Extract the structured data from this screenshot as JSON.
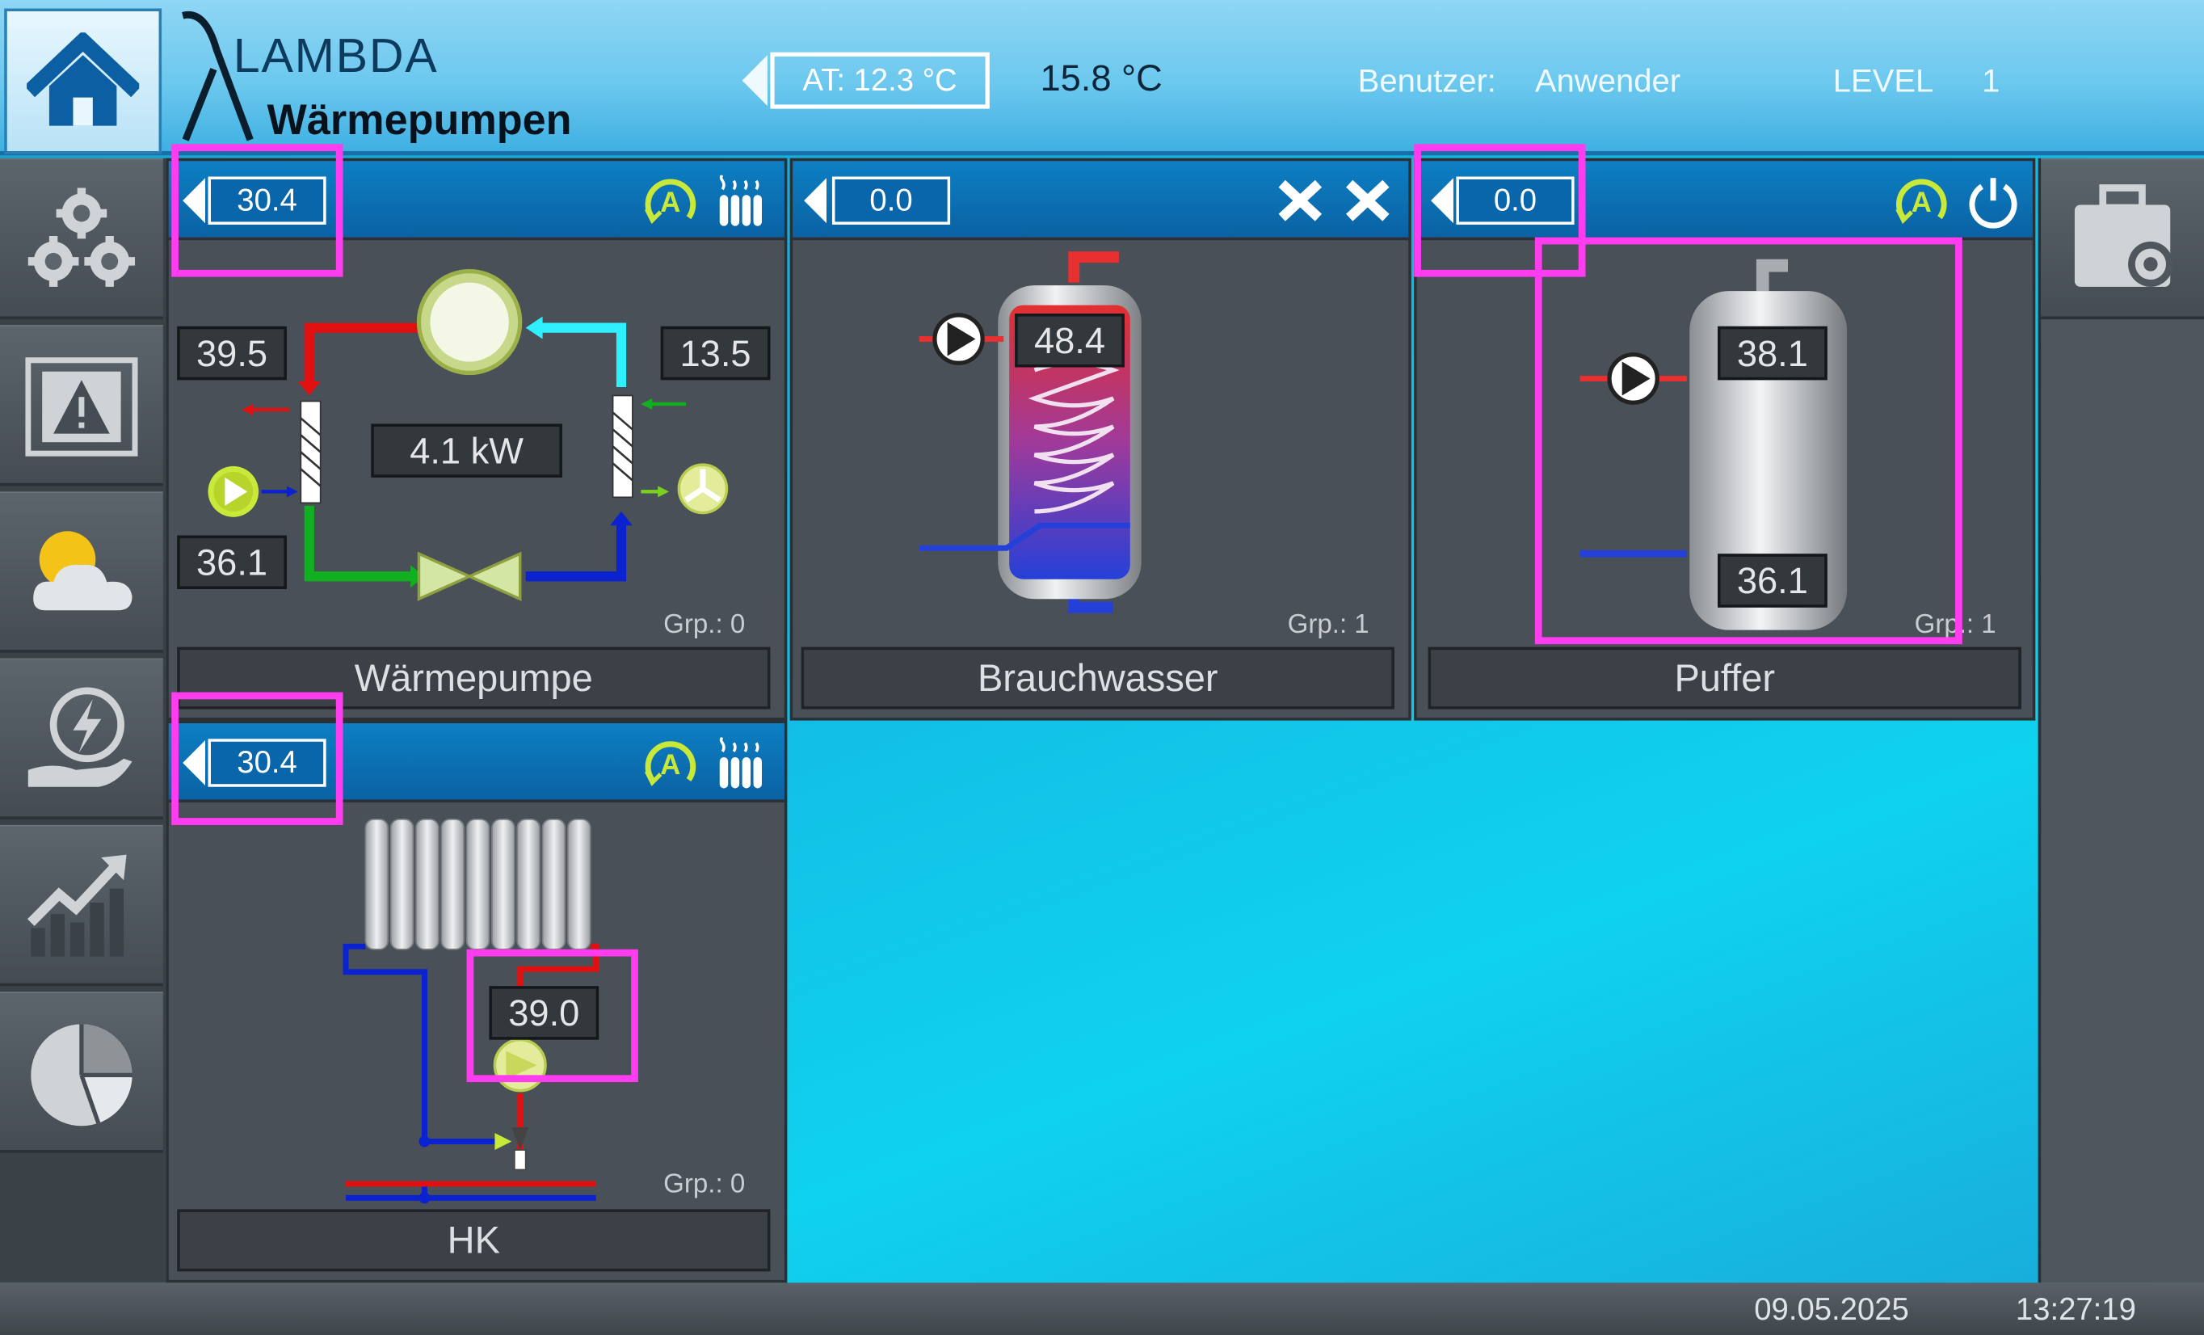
{
  "header": {
    "logo_line1": "LAMBDA",
    "logo_line2": "Wärmepumpen",
    "outside_temp": "AT: 12.3 °C",
    "temp2": "15.8 °C",
    "user_label": "Benutzer:",
    "user_value": "Anwender",
    "level_label": "LEVEL",
    "level_value": "1"
  },
  "left_sidebar": [
    "home-icon",
    "settings-gears-icon",
    "alarm-warning-icon",
    "weather-icon",
    "energy-icon",
    "statistics-icon",
    "pie-chart-icon"
  ],
  "right_sidebar": [
    "service-toolbox-icon"
  ],
  "panels": {
    "heatpump": {
      "setpoint": "30.4",
      "flow_temp": "39.5",
      "source_temp": "13.5",
      "return_temp": "36.1",
      "power": "4.1 kW",
      "group": "Grp.: 0",
      "label": "Wärmepumpe",
      "icons": [
        "auto-mode-icon",
        "heating-icon"
      ]
    },
    "brauchwasser": {
      "setpoint": "0.0",
      "tank_temp": "48.4",
      "group": "Grp.: 1",
      "label": "Brauchwasser",
      "icons": [
        "off-x-icon",
        "off-x-icon"
      ]
    },
    "puffer": {
      "setpoint": "0.0",
      "top_temp": "38.1",
      "bottom_temp": "36.1",
      "group": "Grp.: 1",
      "label": "Puffer",
      "icons": [
        "auto-mode-icon",
        "power-icon"
      ]
    },
    "hk": {
      "setpoint": "30.4",
      "flow_temp": "39.0",
      "group": "Grp.: 0",
      "label": "HK",
      "icons": [
        "auto-mode-icon",
        "heating-icon"
      ]
    }
  },
  "footer": {
    "date": "09.05.2025",
    "time": "13:27:19"
  },
  "colors": {
    "highlight": "#ff3cf0",
    "header_blue": "#0a62a3",
    "panel_bg": "#4a5057"
  }
}
